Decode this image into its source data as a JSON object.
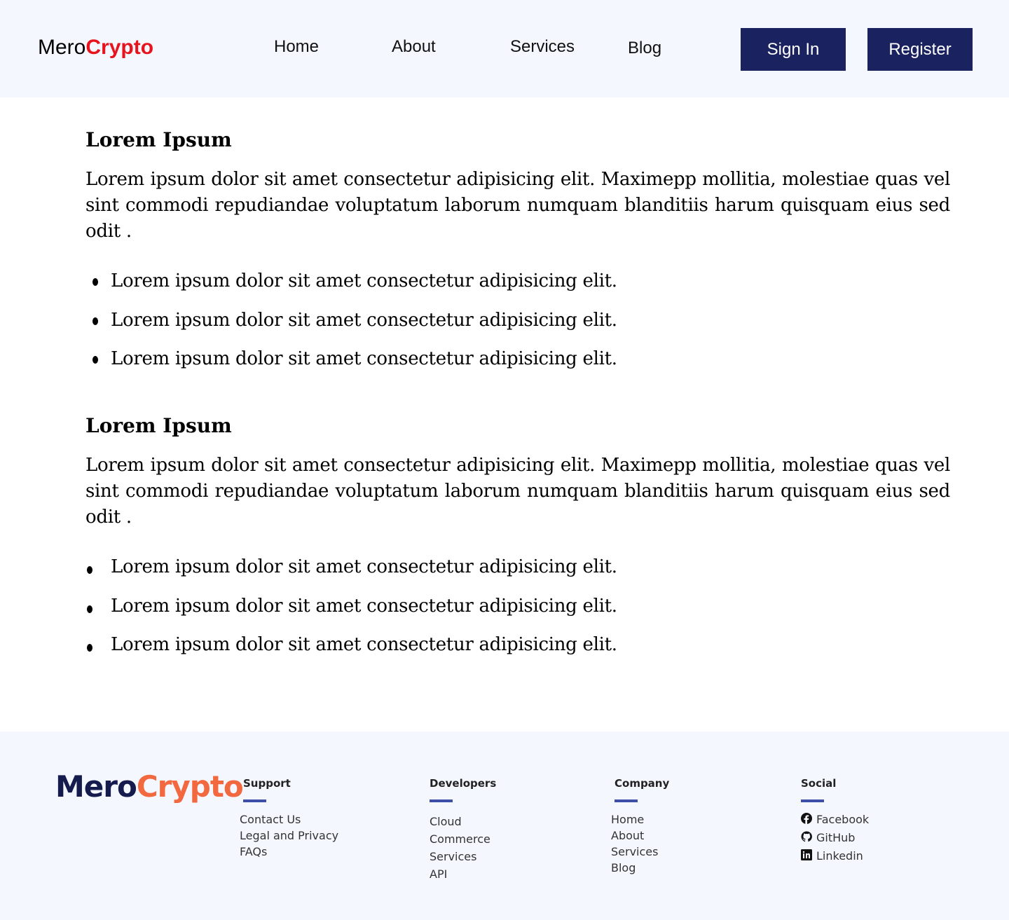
{
  "header": {
    "logo_primary": "Mero",
    "logo_accent": "Crypto",
    "nav": [
      "Home",
      "About",
      "Services",
      "Blog"
    ],
    "signin_label": "Sign In",
    "register_label": "Register"
  },
  "sections": [
    {
      "heading": "Lorem Ipsum",
      "paragraph": "Lorem ipsum dolor sit amet consectetur adipisicing elit. Maximepp mollitia, molestiae quas vel sint commodi repudiandae voluptatum laborum numquam blanditiis harum quisquam eius sed odit .",
      "bullets": [
        "Lorem ipsum dolor sit amet consectetur adipisicing elit.",
        "Lorem ipsum dolor sit amet consectetur adipisicing elit.",
        "Lorem ipsum dolor sit amet consectetur adipisicing elit."
      ]
    },
    {
      "heading": "Lorem Ipsum",
      "paragraph": "Lorem ipsum dolor sit amet consectetur adipisicing elit. Maximepp mollitia, molestiae quas vel sint commodi repudiandae voluptatum laborum numquam blanditiis harum quisquam eius sed odit .",
      "bullets": [
        "Lorem ipsum dolor sit amet consectetur adipisicing elit.",
        "Lorem ipsum dolor sit amet consectetur adipisicing elit.",
        "Lorem ipsum dolor sit amet consectetur adipisicing elit."
      ]
    }
  ],
  "footer": {
    "logo_primary": "Mero",
    "logo_accent": "Crypto",
    "columns": [
      {
        "title": "Support",
        "items": [
          "Contact Us",
          "Legal and Privacy",
          "FAQs"
        ]
      },
      {
        "title": "Developers",
        "items": [
          "Cloud",
          "Commerce",
          "Services",
          "API"
        ]
      },
      {
        "title": "Company",
        "items": [
          "Home",
          "About",
          "Services",
          "Blog"
        ]
      },
      {
        "title": "Social",
        "items": [
          "Facebook",
          "GitHub",
          "Linkedin"
        ],
        "icons": [
          "facebook-icon",
          "github-icon",
          "linkedin-icon"
        ]
      }
    ]
  },
  "colors": {
    "header_bg": "#f4f7fe",
    "button_bg": "#1a2360",
    "logo_accent": "#e8141d",
    "footer_logo_dark": "#151b4d",
    "footer_logo_accent": "#f2683f",
    "footer_bar": "#3e4fa8"
  }
}
